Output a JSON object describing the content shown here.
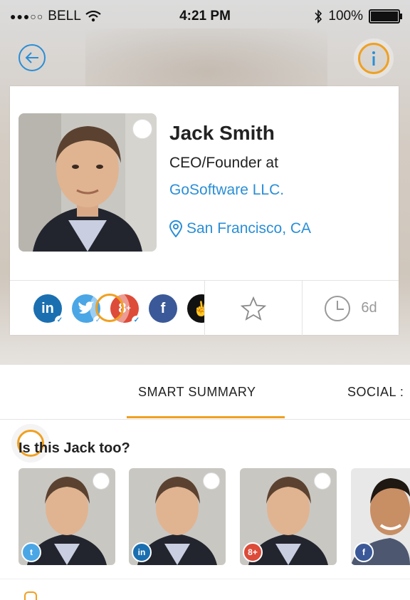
{
  "status_bar": {
    "signal": "●●●○○",
    "carrier": "BELL",
    "time": "4:21 PM",
    "battery": "100%"
  },
  "profile": {
    "name": "Jack Smith",
    "title": "CEO/Founder at",
    "company": "GoSoftware LLC.",
    "location": "San Francisco, CA",
    "last_seen": "6d"
  },
  "social_networks": [
    "linkedin-icon",
    "twitter-icon",
    "google-plus-icon",
    "facebook-icon",
    "angellist-icon"
  ],
  "tabs": {
    "smart_summary": "SMART SUMMARY",
    "social": "SOCIAL :"
  },
  "suggestions": {
    "title": "Is this Jack too?",
    "items": [
      {
        "network": "twitter-icon"
      },
      {
        "network": "linkedin-icon"
      },
      {
        "network": "google-plus-icon"
      },
      {
        "network": "facebook-icon"
      }
    ]
  },
  "colors": {
    "accent_orange": "#f0a020",
    "link_blue": "#2a8ed6",
    "linkedin": "#1a6fb0",
    "twitter": "#4ba6e6",
    "google_plus": "#dd4b39",
    "facebook": "#3b5998"
  }
}
